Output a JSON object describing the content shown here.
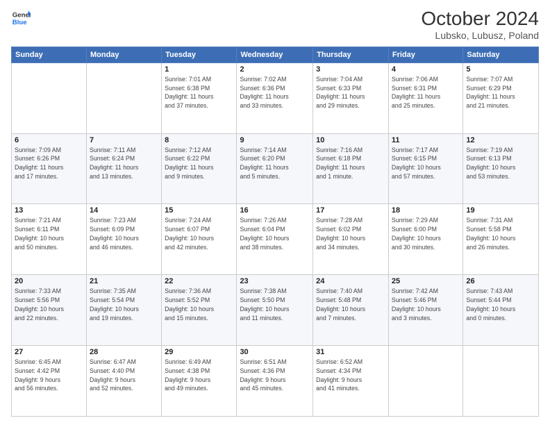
{
  "logo": {
    "line1": "General",
    "line2": "Blue"
  },
  "title": "October 2024",
  "subtitle": "Lubsko, Lubusz, Poland",
  "days_of_week": [
    "Sunday",
    "Monday",
    "Tuesday",
    "Wednesday",
    "Thursday",
    "Friday",
    "Saturday"
  ],
  "weeks": [
    [
      {
        "day": "",
        "detail": ""
      },
      {
        "day": "",
        "detail": ""
      },
      {
        "day": "1",
        "detail": "Sunrise: 7:01 AM\nSunset: 6:38 PM\nDaylight: 11 hours\nand 37 minutes."
      },
      {
        "day": "2",
        "detail": "Sunrise: 7:02 AM\nSunset: 6:36 PM\nDaylight: 11 hours\nand 33 minutes."
      },
      {
        "day": "3",
        "detail": "Sunrise: 7:04 AM\nSunset: 6:33 PM\nDaylight: 11 hours\nand 29 minutes."
      },
      {
        "day": "4",
        "detail": "Sunrise: 7:06 AM\nSunset: 6:31 PM\nDaylight: 11 hours\nand 25 minutes."
      },
      {
        "day": "5",
        "detail": "Sunrise: 7:07 AM\nSunset: 6:29 PM\nDaylight: 11 hours\nand 21 minutes."
      }
    ],
    [
      {
        "day": "6",
        "detail": "Sunrise: 7:09 AM\nSunset: 6:26 PM\nDaylight: 11 hours\nand 17 minutes."
      },
      {
        "day": "7",
        "detail": "Sunrise: 7:11 AM\nSunset: 6:24 PM\nDaylight: 11 hours\nand 13 minutes."
      },
      {
        "day": "8",
        "detail": "Sunrise: 7:12 AM\nSunset: 6:22 PM\nDaylight: 11 hours\nand 9 minutes."
      },
      {
        "day": "9",
        "detail": "Sunrise: 7:14 AM\nSunset: 6:20 PM\nDaylight: 11 hours\nand 5 minutes."
      },
      {
        "day": "10",
        "detail": "Sunrise: 7:16 AM\nSunset: 6:18 PM\nDaylight: 11 hours\nand 1 minute."
      },
      {
        "day": "11",
        "detail": "Sunrise: 7:17 AM\nSunset: 6:15 PM\nDaylight: 10 hours\nand 57 minutes."
      },
      {
        "day": "12",
        "detail": "Sunrise: 7:19 AM\nSunset: 6:13 PM\nDaylight: 10 hours\nand 53 minutes."
      }
    ],
    [
      {
        "day": "13",
        "detail": "Sunrise: 7:21 AM\nSunset: 6:11 PM\nDaylight: 10 hours\nand 50 minutes."
      },
      {
        "day": "14",
        "detail": "Sunrise: 7:23 AM\nSunset: 6:09 PM\nDaylight: 10 hours\nand 46 minutes."
      },
      {
        "day": "15",
        "detail": "Sunrise: 7:24 AM\nSunset: 6:07 PM\nDaylight: 10 hours\nand 42 minutes."
      },
      {
        "day": "16",
        "detail": "Sunrise: 7:26 AM\nSunset: 6:04 PM\nDaylight: 10 hours\nand 38 minutes."
      },
      {
        "day": "17",
        "detail": "Sunrise: 7:28 AM\nSunset: 6:02 PM\nDaylight: 10 hours\nand 34 minutes."
      },
      {
        "day": "18",
        "detail": "Sunrise: 7:29 AM\nSunset: 6:00 PM\nDaylight: 10 hours\nand 30 minutes."
      },
      {
        "day": "19",
        "detail": "Sunrise: 7:31 AM\nSunset: 5:58 PM\nDaylight: 10 hours\nand 26 minutes."
      }
    ],
    [
      {
        "day": "20",
        "detail": "Sunrise: 7:33 AM\nSunset: 5:56 PM\nDaylight: 10 hours\nand 22 minutes."
      },
      {
        "day": "21",
        "detail": "Sunrise: 7:35 AM\nSunset: 5:54 PM\nDaylight: 10 hours\nand 19 minutes."
      },
      {
        "day": "22",
        "detail": "Sunrise: 7:36 AM\nSunset: 5:52 PM\nDaylight: 10 hours\nand 15 minutes."
      },
      {
        "day": "23",
        "detail": "Sunrise: 7:38 AM\nSunset: 5:50 PM\nDaylight: 10 hours\nand 11 minutes."
      },
      {
        "day": "24",
        "detail": "Sunrise: 7:40 AM\nSunset: 5:48 PM\nDaylight: 10 hours\nand 7 minutes."
      },
      {
        "day": "25",
        "detail": "Sunrise: 7:42 AM\nSunset: 5:46 PM\nDaylight: 10 hours\nand 3 minutes."
      },
      {
        "day": "26",
        "detail": "Sunrise: 7:43 AM\nSunset: 5:44 PM\nDaylight: 10 hours\nand 0 minutes."
      }
    ],
    [
      {
        "day": "27",
        "detail": "Sunrise: 6:45 AM\nSunset: 4:42 PM\nDaylight: 9 hours\nand 56 minutes."
      },
      {
        "day": "28",
        "detail": "Sunrise: 6:47 AM\nSunset: 4:40 PM\nDaylight: 9 hours\nand 52 minutes."
      },
      {
        "day": "29",
        "detail": "Sunrise: 6:49 AM\nSunset: 4:38 PM\nDaylight: 9 hours\nand 49 minutes."
      },
      {
        "day": "30",
        "detail": "Sunrise: 6:51 AM\nSunset: 4:36 PM\nDaylight: 9 hours\nand 45 minutes."
      },
      {
        "day": "31",
        "detail": "Sunrise: 6:52 AM\nSunset: 4:34 PM\nDaylight: 9 hours\nand 41 minutes."
      },
      {
        "day": "",
        "detail": ""
      },
      {
        "day": "",
        "detail": ""
      }
    ]
  ]
}
